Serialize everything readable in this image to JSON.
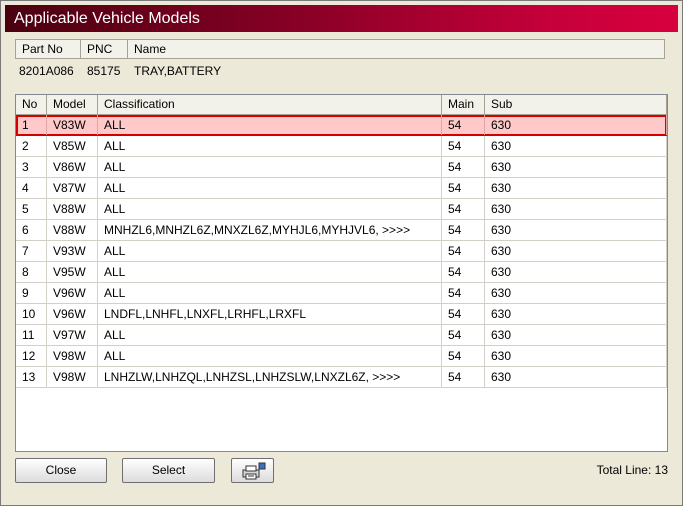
{
  "window": {
    "title": "Applicable Vehicle Models",
    "accent": "#c4003a"
  },
  "part": {
    "headers": [
      "Part No",
      "PNC",
      "Name"
    ],
    "part_no": "8201A086",
    "pnc": "85175",
    "name": "TRAY,BATTERY"
  },
  "grid": {
    "columns": [
      "No",
      "Model",
      "Classification",
      "Main",
      "Sub"
    ],
    "selected_index": 0,
    "selected_color": "#ffc9c9",
    "rows": [
      {
        "no": "1",
        "model": "V83W",
        "classification": "ALL",
        "main": "54",
        "sub": "630"
      },
      {
        "no": "2",
        "model": "V85W",
        "classification": "ALL",
        "main": "54",
        "sub": "630"
      },
      {
        "no": "3",
        "model": "V86W",
        "classification": "ALL",
        "main": "54",
        "sub": "630"
      },
      {
        "no": "4",
        "model": "V87W",
        "classification": "ALL",
        "main": "54",
        "sub": "630"
      },
      {
        "no": "5",
        "model": "V88W",
        "classification": "ALL",
        "main": "54",
        "sub": "630"
      },
      {
        "no": "6",
        "model": "V88W",
        "classification": "MNHZL6,MNHZL6Z,MNXZL6Z,MYHJL6,MYHJVL6,  >>>>",
        "main": "54",
        "sub": "630"
      },
      {
        "no": "7",
        "model": "V93W",
        "classification": "ALL",
        "main": "54",
        "sub": "630"
      },
      {
        "no": "8",
        "model": "V95W",
        "classification": "ALL",
        "main": "54",
        "sub": "630"
      },
      {
        "no": "9",
        "model": "V96W",
        "classification": "ALL",
        "main": "54",
        "sub": "630"
      },
      {
        "no": "10",
        "model": "V96W",
        "classification": "LNDFL,LNHFL,LNXFL,LRHFL,LRXFL",
        "main": "54",
        "sub": "630"
      },
      {
        "no": "11",
        "model": "V97W",
        "classification": "ALL",
        "main": "54",
        "sub": "630"
      },
      {
        "no": "12",
        "model": "V98W",
        "classification": "ALL",
        "main": "54",
        "sub": "630"
      },
      {
        "no": "13",
        "model": "V98W",
        "classification": "LNHZLW,LNHZQL,LNHZSL,LNHZSLW,LNXZL6Z,  >>>>",
        "main": "54",
        "sub": "630"
      }
    ]
  },
  "footer": {
    "close_label": "Close",
    "select_label": "Select",
    "print_icon": "printer-icon",
    "total_label": "Total Line:",
    "total_value": "13"
  }
}
